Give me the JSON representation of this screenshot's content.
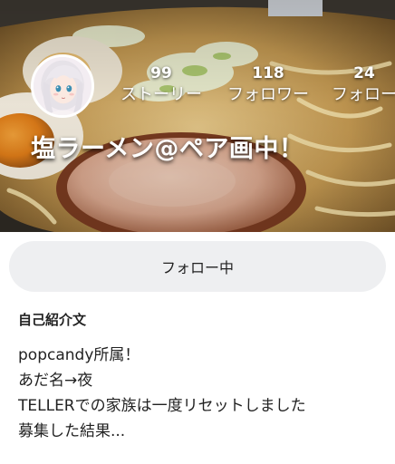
{
  "profile": {
    "name": "塩ラーメン@ペア画中！",
    "stats": [
      {
        "count": "99",
        "label": "ストーリー"
      },
      {
        "count": "118",
        "label": "フォロワー"
      },
      {
        "count": "24",
        "label": "フォロー"
      }
    ]
  },
  "follow_button": {
    "label": "フォロー中"
  },
  "bio": {
    "heading": "自己紹介文",
    "lines": [
      "popcandy所属！",
      "あだ名→夜",
      "TELLERでの家族は一度リセットしました",
      "募集した結果..."
    ]
  },
  "colors": {
    "button_bg": "#eeeff1",
    "text": "#222222",
    "overlay_text": "#ffffff"
  }
}
